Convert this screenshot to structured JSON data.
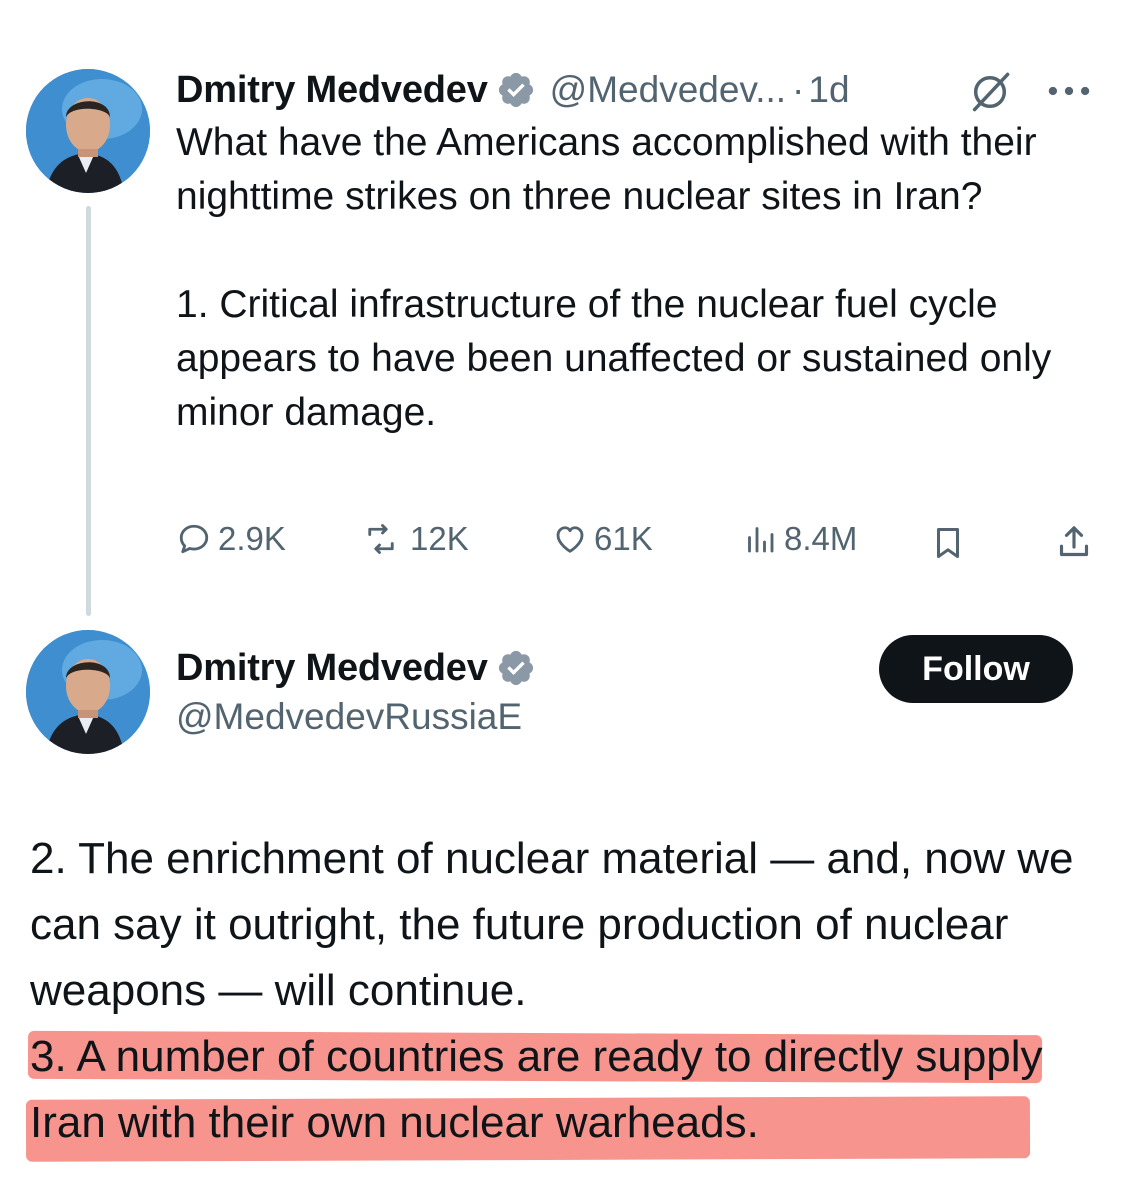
{
  "tweet1": {
    "author_name": "Dmitry Medvedev",
    "handle": "@Medvedev...",
    "separator": "·",
    "time": "1d",
    "text_lines": [
      "What have the Americans accomplished with their nighttime strikes on three nuclear sites in Iran?",
      "1. Critical infrastructure of the nuclear fuel cycle appears to have been unaffected or sustained only minor damage."
    ],
    "stats": {
      "replies": "2.9K",
      "reposts": "12K",
      "likes": "61K",
      "views": "8.4M"
    }
  },
  "tweet2": {
    "author_name": "Dmitry Medvedev",
    "handle": "@MedvedevRussiaE",
    "follow_label": "Follow",
    "paragraph_2": "2. The enrichment of nuclear material — and, now we can say it outright, the future production of nuclear weapons — will continue.",
    "paragraph_3": "3. A number of countries are ready to directly supply Iran with their own nuclear warheads.",
    "highlight_color": "#f47c74"
  },
  "colors": {
    "text": "#0f1419",
    "secondary": "#536471",
    "verified_gold": "#8b98a5",
    "follow_bg": "#0f1419"
  },
  "icons": [
    "verified-badge-icon",
    "grok-icon",
    "more-icon",
    "reply-icon",
    "repost-icon",
    "like-icon",
    "views-icon",
    "bookmark-icon",
    "share-icon"
  ]
}
